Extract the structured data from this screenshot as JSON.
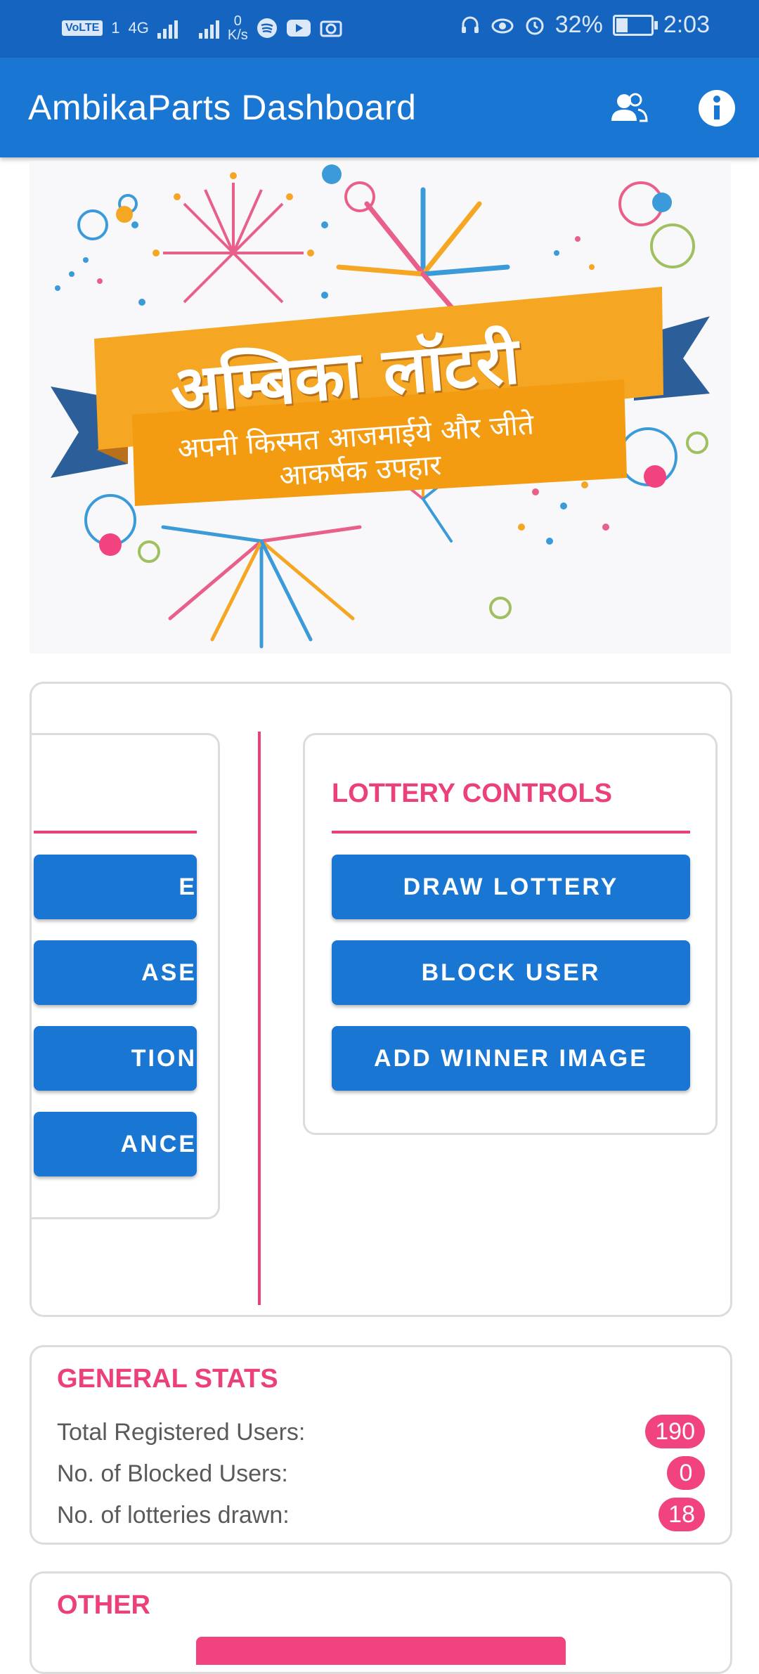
{
  "status_bar": {
    "volte": "VoLTE",
    "sim1": "1",
    "net_type": "4G",
    "net_speed_value": "0",
    "net_speed_unit": "K/s",
    "battery_percent": "32%",
    "battery_level": 0.32,
    "time": "2:03"
  },
  "app_bar": {
    "title": "AmbikaParts Dashboard",
    "users_icon": "users-icon",
    "info_icon": "info-icon"
  },
  "banner": {
    "title": "अम्बिका लॉटरी",
    "subtitle_line1": "अपनी किस्मत आजमाईये और जीते",
    "subtitle_line2": "आकर्षक उपहार"
  },
  "left_panel": {
    "buttons": [
      "E",
      "ASE",
      "TION",
      "ANCE"
    ]
  },
  "lottery_controls": {
    "heading": "LOTTERY CONTROLS",
    "buttons": [
      "DRAW LOTTERY",
      "BLOCK USER",
      "ADD WINNER IMAGE"
    ]
  },
  "general_stats": {
    "heading": "GENERAL STATS",
    "rows": [
      {
        "label": "Total Registered Users:",
        "value": "190"
      },
      {
        "label": "No. of Blocked Users:",
        "value": "0"
      },
      {
        "label": "No. of lotteries drawn:",
        "value": "18"
      }
    ]
  },
  "other": {
    "heading": "OTHER"
  },
  "colors": {
    "status_bar": "#1565c0",
    "app_bar": "#1976d2",
    "accent_pink": "#ec407a",
    "button_blue": "#1976d2",
    "banner_ribbon_orange": "#f5a623",
    "banner_ribbon_blue": "#2c5f9a"
  }
}
